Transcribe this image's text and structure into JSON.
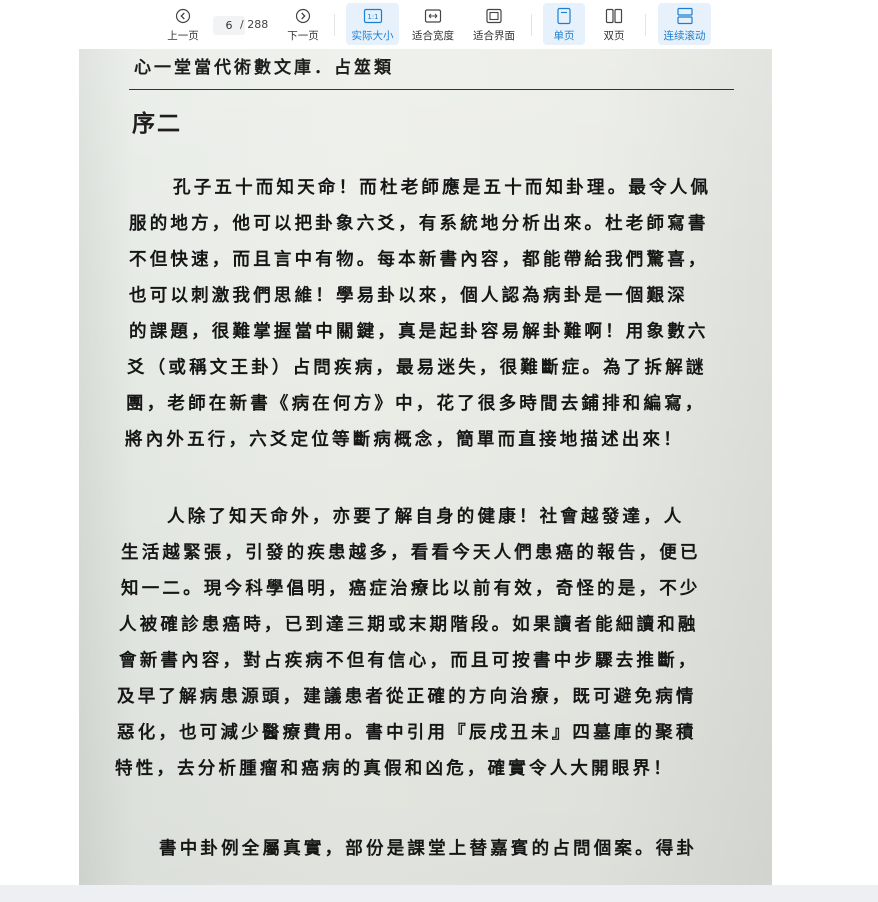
{
  "toolbar": {
    "prev_label": "上一页",
    "current_page": "6",
    "total_pages": "/ 288",
    "next_label": "下一页",
    "actual_size_label": "实际大小",
    "actual_size_icon_text": "1:1",
    "fit_width_label": "适合宽度",
    "fit_page_label": "适合界面",
    "single_page_label": "单页",
    "double_page_label": "双页",
    "continuous_label": "连续滚动",
    "accent_color": "#1a7fd4"
  },
  "document": {
    "running_head": "心一堂當代術數文庫．占筮類",
    "section_title": "序二",
    "paragraphs": [
      {
        "lines": [
          "孔子五十而知天命！而杜老師應是五十而知卦理。最令人佩",
          "服的地方，他可以把卦象六爻，有系統地分析出來。杜老師寫書",
          "不但快速，而且言中有物。每本新書內容，都能帶給我們驚喜，",
          "也可以刺激我們思維！學易卦以來，個人認為病卦是一個艱深",
          "的課題，很難掌握當中關鍵，真是起卦容易解卦難啊！用象數六",
          "爻（或稱文王卦）占問疾病，最易迷失，很難斷症。為了拆解謎",
          "團，老師在新書《病在何方》中，花了很多時間去鋪排和編寫，",
          "將內外五行，六爻定位等斷病概念，簡單而直接地描述出來！"
        ]
      },
      {
        "lines": [
          "人除了知天命外，亦要了解自身的健康！社會越發達，人",
          "生活越緊張，引發的疾患越多，看看今天人們患癌的報告，便已",
          "知一二。現今科學倡明，癌症治療比以前有效，奇怪的是，不少",
          "人被確診患癌時，已到達三期或末期階段。如果讀者能細讀和融",
          "會新書內容，對占疾病不但有信心，而且可按書中步驟去推斷，",
          "及早了解病患源頭，建議患者從正確的方向治療，既可避免病情",
          "惡化，也可減少醫療費用。書中引用『辰戌丑未』四墓庫的聚積",
          "特性，去分析腫瘤和癌病的真假和凶危，確實令人大開眼界！"
        ]
      },
      {
        "lines": [
          "書中卦例全屬真實，部份是課堂上替嘉賓的占問個案。得卦"
        ]
      }
    ]
  }
}
